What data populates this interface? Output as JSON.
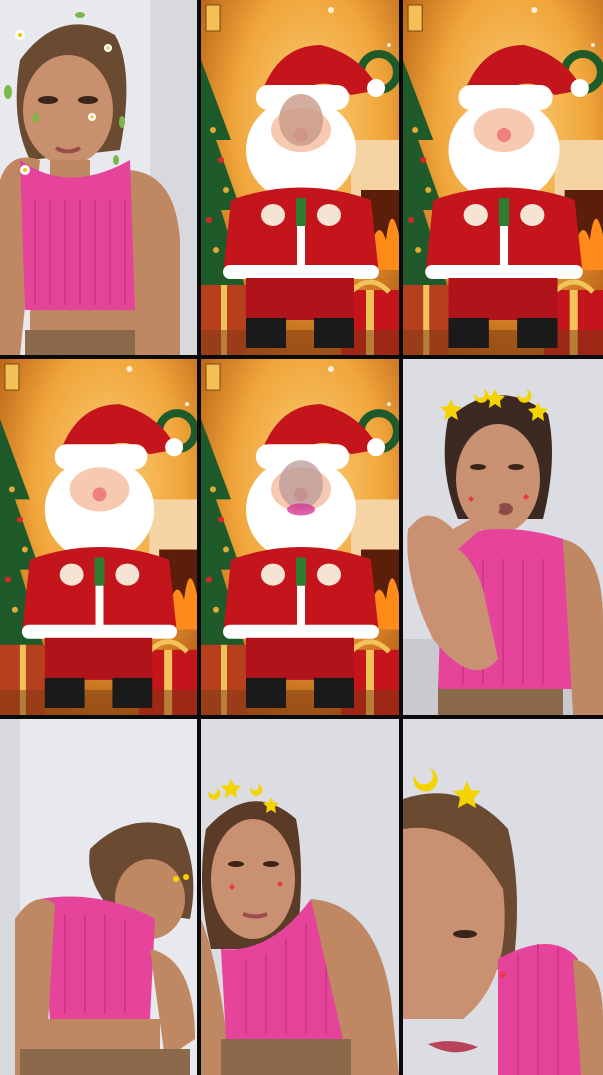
{
  "layout": {
    "type": "video-grid",
    "rows": 3,
    "cols": 3
  },
  "tiles": [
    {
      "id": "t1",
      "kind": "camera",
      "filter": "flower-crown"
    },
    {
      "id": "t2",
      "kind": "santa-avatar",
      "face_overlay": true
    },
    {
      "id": "t3",
      "kind": "santa-avatar",
      "face_overlay": false
    },
    {
      "id": "t4",
      "kind": "santa-avatar",
      "face_overlay": false
    },
    {
      "id": "t5",
      "kind": "santa-avatar",
      "face_overlay": true
    },
    {
      "id": "t6",
      "kind": "camera",
      "filter": "star-moon-crown"
    },
    {
      "id": "t7",
      "kind": "camera",
      "filter": "star-moon-crown"
    },
    {
      "id": "t8",
      "kind": "camera",
      "filter": "star-moon-crown"
    },
    {
      "id": "t9",
      "kind": "camera",
      "filter": "star-moon-crown"
    }
  ],
  "colors": {
    "top_magenta": "#e6449b",
    "santa_red": "#c3151b",
    "room_gold": "#f0a53a",
    "wall_grey": "#dbdde3"
  }
}
